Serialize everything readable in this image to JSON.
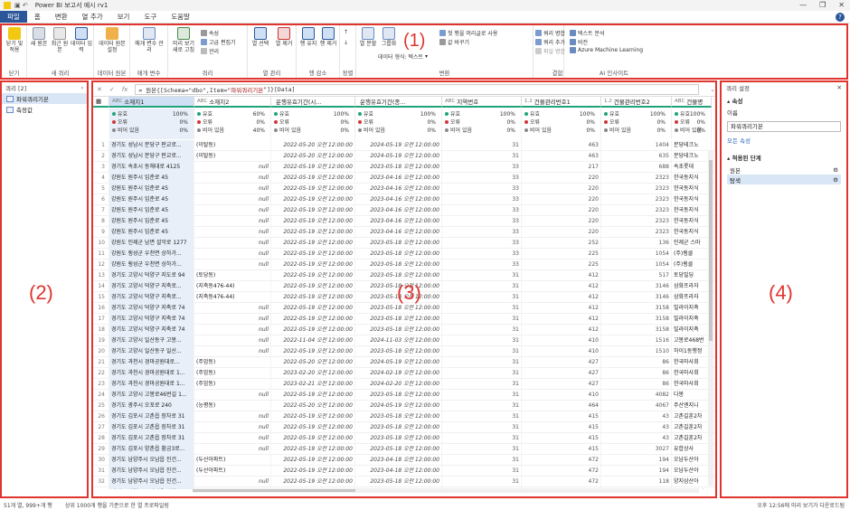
{
  "window": {
    "title": "Power BI 보고서 예시 rv1"
  },
  "menu": {
    "tabs": [
      "파일",
      "홈",
      "변환",
      "열 추가",
      "보기",
      "도구",
      "도움말"
    ]
  },
  "ribbon": {
    "groups": [
      {
        "label": "닫기",
        "buttons": [
          "닫기 및 적용"
        ]
      },
      {
        "label": "새 쿼리",
        "buttons": [
          "새 원본",
          "최근 원본",
          "데이터 입력"
        ]
      },
      {
        "label": "데이터 원본",
        "buttons": [
          "데이터 원본 설정"
        ]
      },
      {
        "label": "매개 변수",
        "buttons": [
          "매개 변수 관리"
        ]
      },
      {
        "label": "쿼리",
        "buttons": [
          "미리 보기 새로 고침"
        ],
        "small": [
          "속성",
          "고급 편집기",
          "관리"
        ]
      },
      {
        "label": "열 관리",
        "buttons": [
          "열 선택",
          "열 제거"
        ]
      },
      {
        "label": "행 감소",
        "buttons": [
          "행 유지",
          "행 제거"
        ]
      },
      {
        "label": "정렬",
        "buttons": []
      },
      {
        "label": "변환",
        "buttons": [
          "열 분할",
          "그룹화"
        ],
        "small": [
          "데이터 형식: 텍스트",
          "첫 행을 머리글로 사용",
          "값 바꾸기"
        ]
      },
      {
        "label": "결합",
        "buttons": [],
        "small": [
          "쿼리 병합",
          "쿼리 추가",
          "파일 병합"
        ]
      },
      {
        "label": "AI 인사이트",
        "buttons": [],
        "small": [
          "텍스트 분석",
          "비전",
          "Azure Machine Learning"
        ]
      }
    ]
  },
  "annotations": [
    "(1)",
    "(2)",
    "(3)",
    "(4)"
  ],
  "left_pane": {
    "title": "쿼리 [2]",
    "queries": [
      "파워쿼리기본",
      "측정값"
    ]
  },
  "formula_bar": {
    "prefix": "= 원본{[Schema=\"dbo\",Item=\"",
    "string": "파워쿼리기본",
    "suffix": "\"]}[Data]"
  },
  "columns": [
    {
      "type": "ABC",
      "name": "소재지1"
    },
    {
      "type": "ABC",
      "name": "소재지2"
    },
    {
      "type": "",
      "name": "운행유효기간(시..."
    },
    {
      "type": "",
      "name": "운행유효기간(종..."
    },
    {
      "type": "ABC",
      "name": "지역번호"
    },
    {
      "type": "1.2",
      "name": "건물관리번호1"
    },
    {
      "type": "1.2",
      "name": "건물관리번호2"
    },
    {
      "type": "ABC",
      "name": "건물명"
    }
  ],
  "column_stats": [
    {
      "valid": "100%",
      "error": "0%",
      "empty": "0%"
    },
    {
      "valid": "60%",
      "error": "0%",
      "empty": "40%"
    },
    {
      "valid": "100%",
      "error": "0%",
      "empty": "0%"
    },
    {
      "valid": "100%",
      "error": "0%",
      "empty": "0%"
    },
    {
      "valid": "100%",
      "error": "0%",
      "empty": "0%"
    },
    {
      "valid": "100%",
      "error": "0%",
      "empty": "0%"
    },
    {
      "valid": "100%",
      "error": "0%",
      "empty": "0%"
    },
    {
      "valid": "100%",
      "error": "0%",
      "empty": "0%"
    }
  ],
  "stat_labels": {
    "valid": "유효",
    "error": "오류",
    "empty": "비어 있음"
  },
  "rows": [
    [
      "경기도 성남시 분당구 판교로...",
      "(이탈동)",
      "2022-05-20 오전 12:00:00",
      "2024-05-19 오전 12:00:00",
      "31",
      "463",
      "1404",
      "분당테크노"
    ],
    [
      "경기도 성남시 분당구 판교로...",
      "(이탈동)",
      "2022-05-20 오전 12:00:00",
      "2024-05-19 오전 12:00:00",
      "31",
      "463",
      "635",
      "분당테크노"
    ],
    [
      "경기도 속초시 동해대로 4125",
      "null",
      "2022-05-19 오전 12:00:00",
      "2023-05-18 오전 12:00:00",
      "33",
      "217",
      "688",
      "속초롯데"
    ],
    [
      "강원도 원주시 입춘로 45",
      "null",
      "2022-05-19 오전 12:00:00",
      "2023-04-16 오전 12:00:00",
      "33",
      "220",
      "2323",
      "한국동지식"
    ],
    [
      "강원도 원주시 입춘로 45",
      "null",
      "2022-05-19 오전 12:00:00",
      "2023-04-16 오전 12:00:00",
      "33",
      "220",
      "2323",
      "한국동지식"
    ],
    [
      "강원도 원주시 입춘로 45",
      "null",
      "2022-05-19 오전 12:00:00",
      "2023-04-16 오전 12:00:00",
      "33",
      "220",
      "2323",
      "한국동지식"
    ],
    [
      "강원도 원주시 입춘로 45",
      "null",
      "2022-05-19 오전 12:00:00",
      "2023-04-16 오전 12:00:00",
      "33",
      "220",
      "2323",
      "한국동지식"
    ],
    [
      "강원도 원주시 입춘로 45",
      "null",
      "2022-05-19 오전 12:00:00",
      "2023-04-16 오전 12:00:00",
      "33",
      "220",
      "2323",
      "한국동지식"
    ],
    [
      "강원도 원주시 입춘로 45",
      "null",
      "2022-05-19 오전 12:00:00",
      "2023-04-16 오전 12:00:00",
      "33",
      "220",
      "2323",
      "한국동지식"
    ],
    [
      "강원도 인제군 남면 설악로 1277",
      "null",
      "2022-05-19 오전 12:00:00",
      "2023-05-18 오전 12:00:00",
      "33",
      "252",
      "136",
      "인제군 스마"
    ],
    [
      "강원도 횡성군 우천면 상하가...",
      "null",
      "2022-05-19 오전 12:00:00",
      "2023-05-18 오전 12:00:00",
      "33",
      "225",
      "1054",
      "(주)횡클"
    ],
    [
      "강원도 횡성군 우천면 상하가...",
      "null",
      "2022-05-19 오전 12:00:00",
      "2023-05-18 오전 12:00:00",
      "33",
      "225",
      "1054",
      "(주)횡클"
    ],
    [
      "경기도 고양시 덕양구 지도로 94",
      "(토당동)",
      "2022-05-19 오전 12:00:00",
      "2023-05-18 오전 12:00:00",
      "31",
      "412",
      "517",
      "토당빌딩"
    ],
    [
      "경기도 고양시 덕양구 지축로...",
      "(지축동476-44)",
      "2022-05-19 오전 12:00:00",
      "2023-05-18 오전 12:00:00",
      "31",
      "412",
      "3146",
      "삼화프라자"
    ],
    [
      "경기도 고양시 덕양구 지축로...",
      "(지축동476-44)",
      "2022-05-19 오전 12:00:00",
      "2023-05-18 오전 12:00:00",
      "31",
      "412",
      "3146",
      "삼화프라자"
    ],
    [
      "경기도 고양시 덕양구 지축로 74",
      "null",
      "2022-05-19 오전 12:00:00",
      "2023-05-18 오전 12:00:00",
      "31",
      "412",
      "3158",
      "빌라이지축"
    ],
    [
      "경기도 고양시 덕양구 지축로 74",
      "null",
      "2022-05-19 오전 12:00:00",
      "2023-05-18 오전 12:00:00",
      "31",
      "412",
      "3158",
      "빌라이지축"
    ],
    [
      "경기도 고양시 덕양구 지축로 74",
      "null",
      "2022-05-19 오전 12:00:00",
      "2023-05-18 오전 12:00:00",
      "31",
      "412",
      "3158",
      "빌라이지축"
    ],
    [
      "경기도 고양시 일산동구 고봉...",
      "null",
      "2022-11-04 오전 12:00:00",
      "2024-11-03 오전 12:00:00",
      "31",
      "410",
      "1516",
      "고봉로468번"
    ],
    [
      "경기도 고양시 일산동구 일산...",
      "null",
      "2022-05-19 오전 12:00:00",
      "2023-05-18 오전 12:00:00",
      "31",
      "410",
      "1510",
      "하이1동행정"
    ],
    [
      "경기도 과천시 경마공원대로...",
      "(주암동)",
      "2022-05-20 오전 12:00:00",
      "2024-05-19 오전 12:00:00",
      "31",
      "427",
      "86",
      "한국마사회"
    ],
    [
      "경기도 과천시 경마공원대로 1...",
      "(주암동)",
      "2023-02-20 오전 12:00:00",
      "2024-02-19 오전 12:00:00",
      "31",
      "427",
      "86",
      "한국마사회"
    ],
    [
      "경기도 과천시 경마공원대로 1...",
      "(주암동)",
      "2023-02-21 오전 12:00:00",
      "2024-02-20 오전 12:00:00",
      "31",
      "427",
      "86",
      "한국마사회"
    ],
    [
      "경기도 고양시 고봉로46번길 1...",
      "null",
      "2022-05-19 오전 12:00:00",
      "2023-05-18 오전 12:00:00",
      "31",
      "410",
      "4082",
      "다봉"
    ],
    [
      "경기도 광주시 오포로 240",
      "(능평동)",
      "2022-05-20 오전 12:00:00",
      "2024-05-19 오전 12:00:00",
      "31",
      "464",
      "4067",
      "주산엔지니"
    ],
    [
      "경기도 김포시 고촌읍 장차로 31",
      "null",
      "2022-05-19 오전 12:00:00",
      "2023-05-18 오전 12:00:00",
      "31",
      "415",
      "43",
      "고촌길훈2차"
    ],
    [
      "경기도 김포시 고촌읍 장차로 31",
      "null",
      "2022-05-19 오전 12:00:00",
      "2023-05-18 오전 12:00:00",
      "31",
      "415",
      "43",
      "고촌길훈2차"
    ],
    [
      "경기도 김포시 고촌읍 장차로 31",
      "null",
      "2022-05-19 오전 12:00:00",
      "2023-05-18 오전 12:00:00",
      "31",
      "415",
      "43",
      "고촌길훈2차"
    ],
    [
      "경기도 김포시 양촌읍 황금3로...",
      "null",
      "2022-05-19 오전 12:00:00",
      "2023-05-18 오전 12:00:00",
      "31",
      "415",
      "3027",
      "유합상사"
    ],
    [
      "경기도 남양주시 오남읍 진건...",
      "(두산아파트)",
      "2022-05-19 오전 12:00:00",
      "2023-04-18 오전 12:00:00",
      "31",
      "472",
      "194",
      "오남두산아"
    ],
    [
      "경기도 남양주시 오남읍 진건...",
      "(두산아파트)",
      "2022-05-19 오전 12:00:00",
      "2023-04-18 오전 12:00:00",
      "31",
      "472",
      "194",
      "오남두산아"
    ],
    [
      "경기도 남양주시 오남읍 진건...",
      "null",
      "2022-05-19 오전 12:00:00",
      "2023-05-18 오전 12:00:00",
      "31",
      "472",
      "118",
      "양지삼산아"
    ],
    [
      "경기도 남양주시 진접읍 장현...",
      "null",
      "2022-05-19 오전 12:00:00",
      "2023-05-18 오전 12:00:00",
      "31",
      "472",
      "4073",
      "장현리362번"
    ],
    [
      "경기도 남양주시 진접읍 장현...",
      "null",
      "2022-05-19 오전 12:00:00",
      "2023-05-18 오전 12:00:00",
      "31",
      "472",
      "4073",
      "장현리362번"
    ]
  ],
  "right_pane": {
    "title": "쿼리 설정",
    "props_header": "속성",
    "name_label": "이름",
    "name_value": "파워쿼리기본",
    "all_props": "모든 속성",
    "steps_header": "적용된 단계",
    "steps": [
      "원본",
      "탐색"
    ]
  },
  "status": {
    "left": "51개 열, 999+개 행",
    "middle": "상위 1000개 행을 기준으로 한 열 프로파일링",
    "right": "오후 12:56에 미리 보기가 다운로드됨"
  },
  "colors": {
    "accent": "#2b579a",
    "highlight": "#e0342e",
    "valid": "#1fa37a",
    "error": "#d13438",
    "empty": "#888888"
  }
}
